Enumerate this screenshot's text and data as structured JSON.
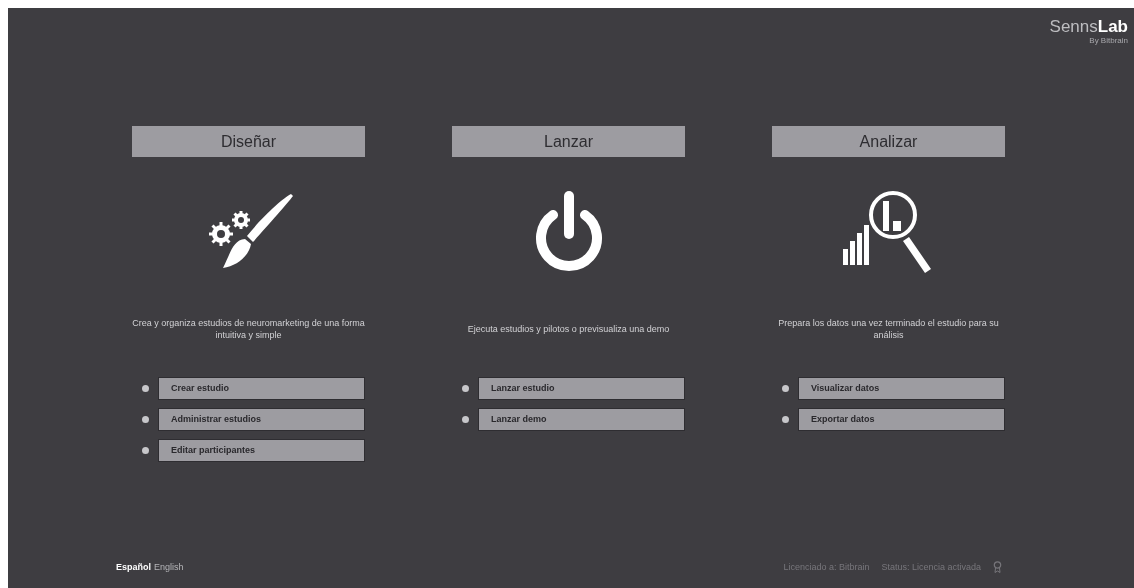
{
  "logo": {
    "brand": "Senns",
    "brand_bold": "Lab",
    "byline": "By Bitbrain"
  },
  "columns": [
    {
      "title": "Diseñar",
      "kind": "design",
      "description": "Crea y organiza estudios de neuromarketing de una forma intuitiva y simple",
      "actions": [
        "Crear estudio",
        "Administrar estudios",
        "Editar participantes"
      ]
    },
    {
      "title": "Lanzar",
      "kind": "launch",
      "description": "Ejecuta estudios y pilotos o previsualiza una demo",
      "actions": [
        "Lanzar estudio",
        "Lanzar demo"
      ]
    },
    {
      "title": "Analizar",
      "kind": "analyze",
      "description": "Prepara los datos una vez terminado el estudio para su análisis",
      "actions": [
        "Visualizar datos",
        "Exportar datos"
      ]
    }
  ],
  "languages": [
    {
      "label": "Español",
      "selected": true
    },
    {
      "label": "English",
      "selected": false
    }
  ],
  "footer": {
    "license": "Licenciado a: Bitbrain",
    "status": "Status: Licencia activada"
  }
}
